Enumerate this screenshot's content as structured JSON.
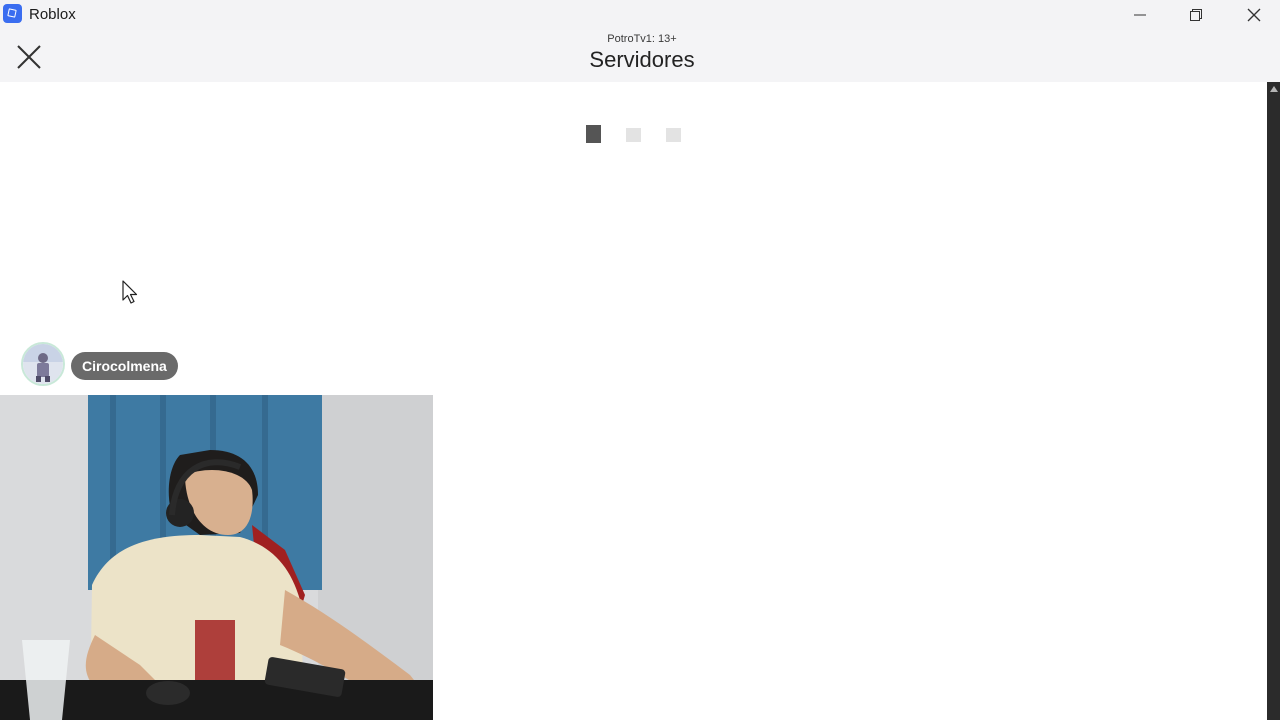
{
  "window": {
    "app_title": "Roblox"
  },
  "header": {
    "subtitle": "PotroTv1: 13+",
    "title": "Servidores"
  },
  "loader": {
    "dots": 3,
    "active_index": 0
  },
  "user": {
    "name": "Cirocolmena"
  },
  "colors": {
    "roblox_blue": "#3a6df0",
    "pill_gray": "#6a6a6a",
    "curtain_blue": "#3e7aa3"
  },
  "icons": {
    "app": "roblox-icon",
    "minimize": "minimize-icon",
    "maximize": "restore-icon",
    "close_window": "close-icon",
    "close_page": "close-x-icon",
    "cursor": "mouse-pointer-icon"
  }
}
